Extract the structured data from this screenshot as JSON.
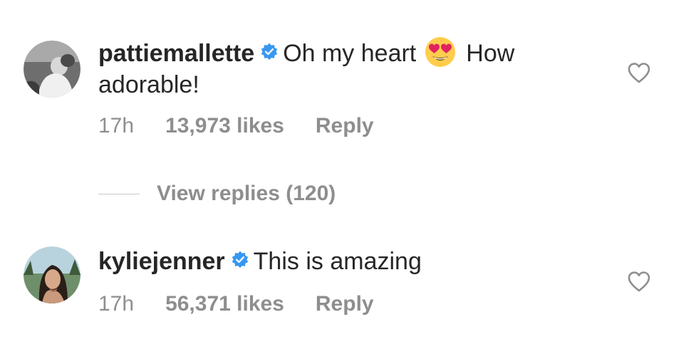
{
  "comments": [
    {
      "username": "pattiemallette",
      "text_before_emoji": "Oh my heart",
      "emoji": "heart-eyes-emoji",
      "text_after_emoji": "How adorable!",
      "time": "17h",
      "likes": "13,973 likes",
      "reply_label": "Reply"
    },
    {
      "username": "kyliejenner",
      "text": "This is amazing",
      "time": "17h",
      "likes": "56,371 likes",
      "reply_label": "Reply"
    }
  ],
  "view_replies_label": "View replies (120)",
  "colors": {
    "text_primary": "#262626",
    "text_secondary": "#8e8e8e",
    "verified_blue": "#3897f0",
    "divider": "#c7c7c7"
  },
  "icons": {
    "verified": "verified-badge-icon",
    "like": "heart-outline-icon"
  }
}
